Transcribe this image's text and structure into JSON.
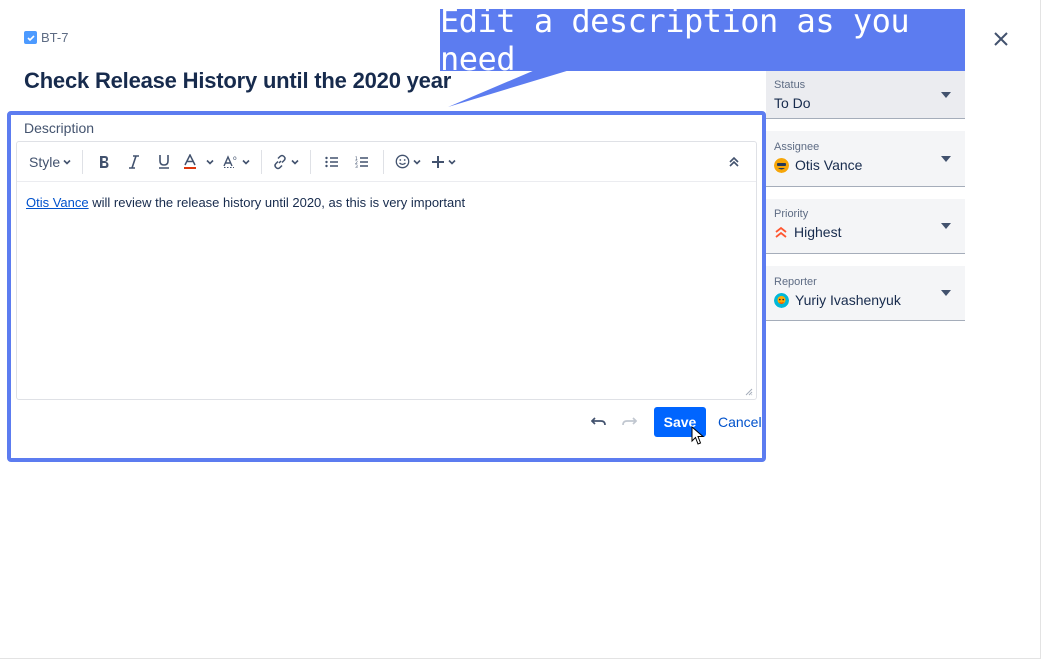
{
  "issue": {
    "key": "BT-7",
    "title": "Check Release History until the 2020 year"
  },
  "callout": {
    "text": "Edit a description as you need"
  },
  "editor": {
    "label": "Description",
    "toolbar": {
      "style_label": "Style"
    },
    "content": {
      "mention": "Otis Vance",
      "text": " will review the release history until 2020, as this is very important"
    }
  },
  "actions": {
    "save_label": "Save",
    "cancel_label": "Cancel"
  },
  "fields": {
    "status": {
      "label": "Status",
      "value": "To Do"
    },
    "assignee": {
      "label": "Assignee",
      "value": "Otis Vance"
    },
    "priority": {
      "label": "Priority",
      "value": "Highest"
    },
    "reporter": {
      "label": "Reporter",
      "value": "Yuriy Ivashenyuk"
    }
  },
  "colors": {
    "accent": "#5c7cf0",
    "save_button": "#0065ff",
    "link": "#0052cc",
    "priority_highest": "#ff5630"
  }
}
